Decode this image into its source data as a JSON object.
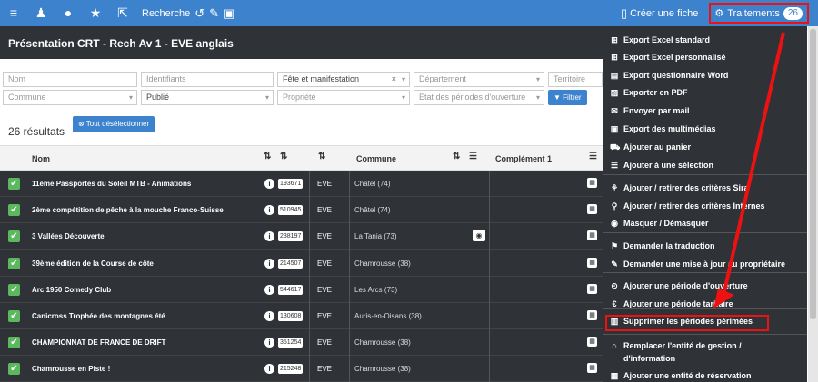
{
  "topbar": {
    "search_label": "Recherche",
    "create_sheet": "Créer une fiche",
    "traitements": "Traitements",
    "traitements_count": "26"
  },
  "header": {
    "title": "Présentation CRT - Rech Av 1 - EVE anglais"
  },
  "filters": {
    "nom": "Nom",
    "identifiants": "Identifiants",
    "fete": "Fête et manifestation",
    "departement": "Département",
    "territoire": "Territoire",
    "commune": "Commune",
    "publie": "Publié",
    "propriete": "Propriété",
    "etat": "Etat des périodes d'ouverture",
    "filter_button": "Filtrer"
  },
  "results": {
    "count_label": "26 résultats",
    "deselect_button": "Tout désélectionner"
  },
  "table": {
    "headers": {
      "nom": "Nom",
      "commune": "Commune",
      "complement": "Complément 1"
    },
    "rows": [
      {
        "name": "11ème Passportes du Soleil MTB - Animations",
        "id": "193671",
        "code": "EVE",
        "commune": "Châtel (74)",
        "cam": false
      },
      {
        "name": "2ème compétition de pêche à la mouche Franco-Suisse",
        "id": "510945",
        "code": "EVE",
        "commune": "Châtel (74)",
        "cam": false
      },
      {
        "name": "3 Vallées Découverte",
        "id": "238197",
        "code": "EVE",
        "commune": "La Tania (73)",
        "cam": true
      },
      {
        "name": "39ème édition de la Course de côte",
        "id": "214507",
        "code": "EVE",
        "commune": "Chamrousse (38)",
        "cam": false
      },
      {
        "name": "Arc 1950 Comedy Club",
        "id": "544617",
        "code": "EVE",
        "commune": "Les Arcs (73)",
        "cam": false
      },
      {
        "name": "Canicross Trophée des montagnes été",
        "id": "130608",
        "code": "EVE",
        "commune": "Auris-en-Oisans (38)",
        "cam": false
      },
      {
        "name": "CHAMPIONNAT DE FRANCE DE DRIFT",
        "id": "351254",
        "code": "EVE",
        "commune": "Chamrousse (38)",
        "cam": false
      },
      {
        "name": "Chamrousse en Piste !",
        "id": "215248",
        "code": "EVE",
        "commune": "Chamrousse (38)",
        "cam": false
      }
    ]
  },
  "menu": {
    "items": [
      {
        "icon": "⊞",
        "label": "Export Excel standard"
      },
      {
        "icon": "⊞",
        "label": "Export Excel personnalisé"
      },
      {
        "icon": "▤",
        "label": "Export questionnaire Word"
      },
      {
        "icon": "▨",
        "label": "Exporter en PDF"
      },
      {
        "icon": "✉",
        "label": "Envoyer par mail"
      },
      {
        "icon": "▣",
        "label": "Export des multimédias"
      },
      {
        "icon": "⛟",
        "label": "Ajouter au panier"
      },
      {
        "icon": "☰",
        "label": "Ajouter à une sélection"
      },
      {
        "icon": "⚘",
        "label": "Ajouter / retirer des critères Sira"
      },
      {
        "icon": "⚲",
        "label": "Ajouter / retirer des critères Internes"
      },
      {
        "icon": "◉",
        "label": "Masquer / Démasquer"
      },
      {
        "icon": "⚑",
        "label": "Demander la traduction"
      },
      {
        "icon": "✎",
        "label": "Demander une mise à jour au propriétaire"
      },
      {
        "icon": "⊙",
        "label": "Ajouter une période d'ouverture"
      },
      {
        "icon": "€",
        "label": "Ajouter une période tarifaire"
      },
      {
        "icon": "▥",
        "label": "Supprimer les périodes périmées"
      },
      {
        "icon": "⌂",
        "label": "Remplacer l'entité de gestion /"
      },
      {
        "icon": "",
        "label": "d'information"
      },
      {
        "icon": "▦",
        "label": "Ajouter une entité de réservation"
      }
    ]
  },
  "colors": {
    "accent": "#3d82cc",
    "dark": "#2f3338",
    "highlight": "#e11111",
    "check": "#5cb85c"
  }
}
